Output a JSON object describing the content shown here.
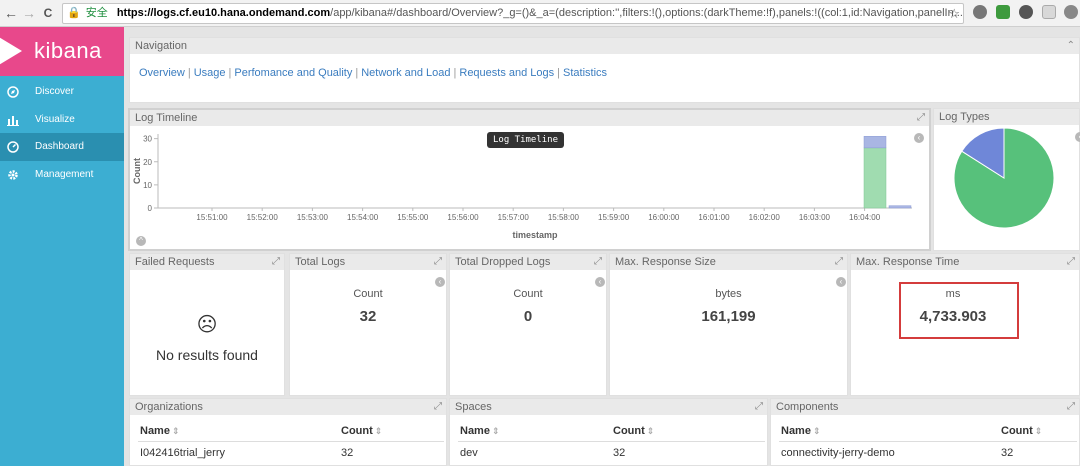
{
  "browser": {
    "back": "←",
    "forward": "→",
    "reload": "C",
    "secure_label": "安全",
    "url_host": "https://logs.cf.eu10.hana.ondemand.com",
    "url_rest": "/app/kibana#/dashboard/Overview?_g=()&_a=(description:'',filters:!(),options:(darkTheme:!f),panels:!((col:1,id:Navigation,panelIn...",
    "star": "☆"
  },
  "sidebar": {
    "brand": "kibana",
    "items": [
      {
        "label": "Discover",
        "icon": "compass-icon",
        "active": false
      },
      {
        "label": "Visualize",
        "icon": "bar-chart-icon",
        "active": false
      },
      {
        "label": "Dashboard",
        "icon": "dashboard-icon",
        "active": true
      },
      {
        "label": "Management",
        "icon": "gear-icon",
        "active": false
      }
    ]
  },
  "navigation": {
    "title": "Navigation",
    "links": [
      "Overview",
      "Usage",
      "Perfomance and Quality",
      "Network and Load",
      "Requests and Logs",
      "Statistics"
    ],
    "separator": "|"
  },
  "log_timeline": {
    "title": "Log Timeline",
    "tooltip": "Log Timeline"
  },
  "log_types": {
    "title": "Log Types"
  },
  "metrics": {
    "failed_requests": {
      "title": "Failed Requests",
      "icon": "☹",
      "message": "No results found"
    },
    "total_logs": {
      "title": "Total Logs",
      "label": "Count",
      "value": "32"
    },
    "total_dropped": {
      "title": "Total Dropped Logs",
      "label": "Count",
      "value": "0"
    },
    "max_response_size": {
      "title": "Max. Response Size",
      "label": "bytes",
      "value": "161,199"
    },
    "max_response_time": {
      "title": "Max. Response Time",
      "label": "ms",
      "value": "4,733.903"
    }
  },
  "tables": {
    "organizations": {
      "title": "Organizations",
      "col_name": "Name",
      "col_count": "Count",
      "rows": [
        {
          "name": "I042416trial_jerry",
          "count": "32"
        }
      ]
    },
    "spaces": {
      "title": "Spaces",
      "col_name": "Name",
      "col_count": "Count",
      "rows": [
        {
          "name": "dev",
          "count": "32"
        }
      ]
    },
    "components": {
      "title": "Components",
      "col_name": "Name",
      "col_count": "Count",
      "rows": [
        {
          "name": "connectivity-jerry-demo",
          "count": "32"
        }
      ]
    }
  },
  "chart_data": [
    {
      "type": "bar",
      "title": "Log Timeline",
      "xlabel": "timestamp",
      "ylabel": "Count",
      "categories": [
        "15:51:00",
        "15:52:00",
        "15:53:00",
        "15:54:00",
        "15:55:00",
        "15:56:00",
        "15:57:00",
        "15:58:00",
        "15:59:00",
        "16:00:00",
        "16:01:00",
        "16:02:00",
        "16:03:00",
        "16:04:00"
      ],
      "yticks": [
        0,
        10,
        20,
        30
      ],
      "ylim": [
        0,
        32
      ],
      "grid": false,
      "series": [
        {
          "values": [
            0,
            0,
            0,
            0,
            0,
            0,
            0,
            0,
            0,
            0,
            0,
            0,
            0,
            26,
            0
          ],
          "color": "#a0dcb0"
        },
        {
          "values": [
            0,
            0,
            0,
            0,
            0,
            0,
            0,
            0,
            0,
            0,
            0,
            0,
            0,
            5,
            1
          ],
          "color": "#a9b6e3"
        }
      ],
      "bar_times": [
        "16:04:00",
        "16:04:30"
      ],
      "stacked": true
    },
    {
      "type": "pie",
      "title": "Log Types",
      "values": [
        84,
        16
      ],
      "colors": [
        "#57c17b",
        "#6f87d8"
      ]
    }
  ]
}
